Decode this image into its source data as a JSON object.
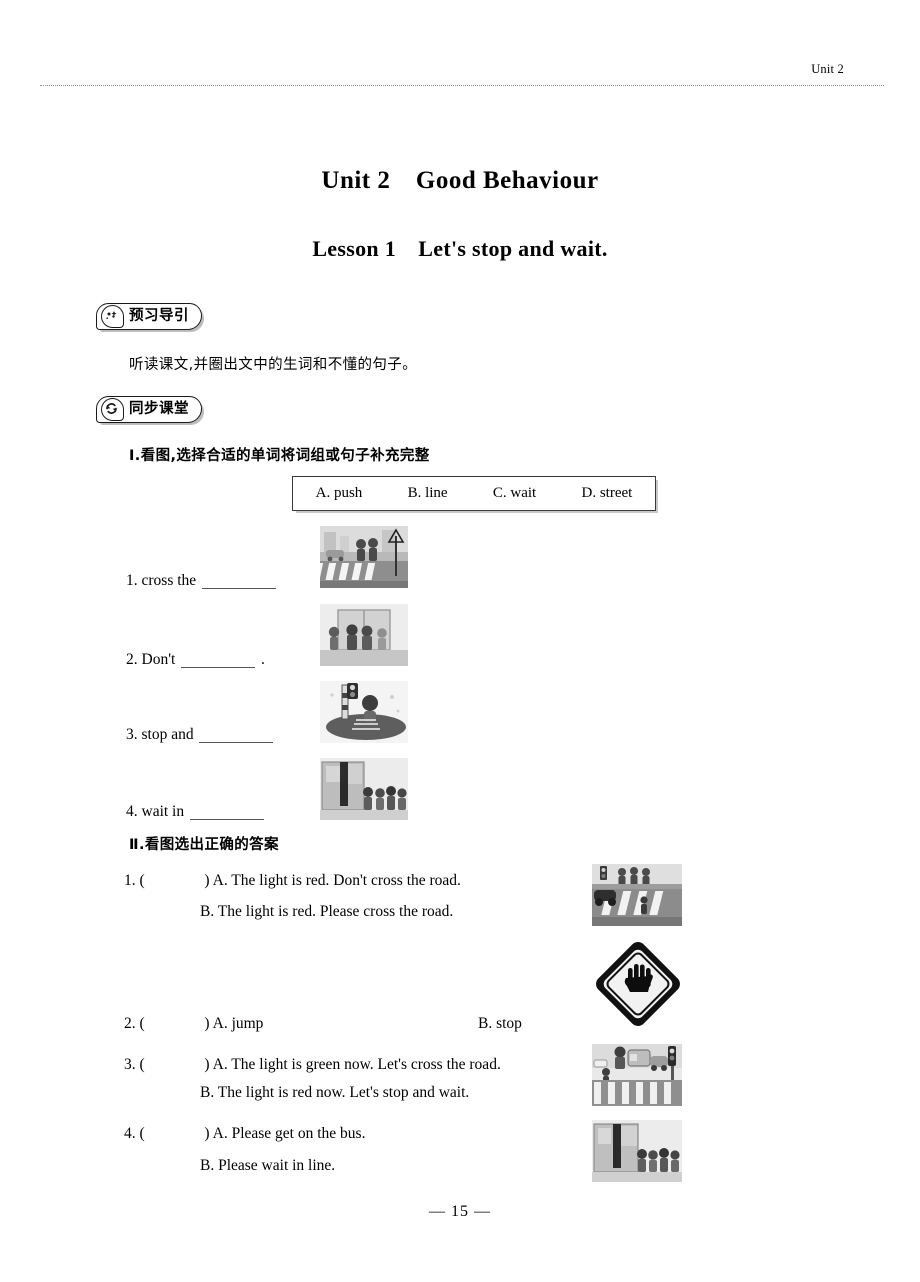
{
  "header": {
    "label": "Unit 2"
  },
  "titles": {
    "unit": "Unit 2　Good Behaviour",
    "lesson": "Lesson 1　Let's stop and wait."
  },
  "sections": {
    "preview": {
      "badge_label": "预习导引",
      "badge_icon": "sparkle-circle-icon",
      "instruction": "听读课文,并圈出文中的生词和不懂的句子。"
    },
    "classroom": {
      "badge_label": "同步课堂",
      "badge_icon": "refresh-circle-icon"
    }
  },
  "exercise_one": {
    "heading": "Ⅰ.看图,选择合适的单词将词组或句子补充完整",
    "word_bank": [
      "A. push",
      "B. line",
      "C. wait",
      "D. street"
    ],
    "items": [
      {
        "num": "1.",
        "before": "cross the",
        "after": "",
        "image": "crosswalk-children-sign-image"
      },
      {
        "num": "2.",
        "before": "Don't",
        "after": ".",
        "image": "children-pushing-door-image"
      },
      {
        "num": "3.",
        "before": "stop and",
        "after": "",
        "image": "child-traffic-light-image"
      },
      {
        "num": "4.",
        "before": "wait in",
        "after": "",
        "image": "bus-queue-children-image"
      }
    ]
  },
  "exercise_two": {
    "heading": "Ⅱ.看图选出正确的答案",
    "items": [
      {
        "num": "1.",
        "paren_open": "(",
        "paren_close": ")",
        "option_a": "A. The light is red. Don't cross the road.",
        "option_b": "B. The light is red. Please cross the road.",
        "layout": "stacked",
        "image": "street-crossing-car-image"
      },
      {
        "num": "2.",
        "paren_open": "(",
        "paren_close": ")",
        "option_a": "A. jump",
        "option_b": "B. stop",
        "layout": "inline",
        "image": "stop-hand-sign-icon"
      },
      {
        "num": "3.",
        "paren_open": "(",
        "paren_close": ")",
        "option_a": "A. The light is green now. Let's cross the road.",
        "option_b": "B. The light is red now. Let's stop and wait.",
        "layout": "stacked",
        "image": "traffic-light-crossing-image"
      },
      {
        "num": "4.",
        "paren_open": "(",
        "paren_close": ")",
        "option_a": "A. Please get on the bus.",
        "option_b": "B. Please wait in line.",
        "layout": "stacked",
        "image": "bus-boarding-queue-image"
      }
    ]
  },
  "footer": {
    "page_number": "— 15 —"
  }
}
